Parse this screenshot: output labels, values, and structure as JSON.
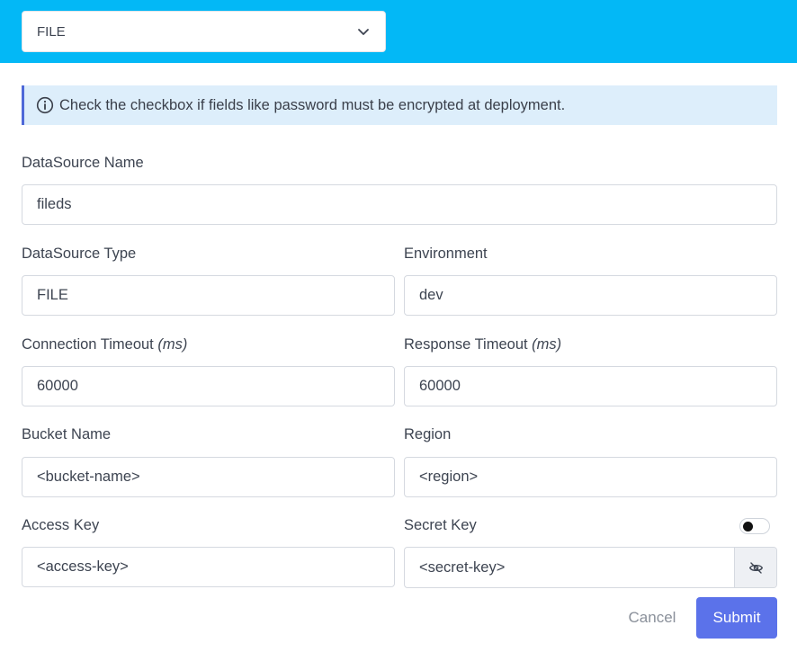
{
  "header": {
    "type_select": {
      "value": "FILE",
      "icon": "chevron-down-icon"
    },
    "background_color": "#03b8f6"
  },
  "info_banner": {
    "icon": "info-circle-icon",
    "text": "Check the checkbox if fields like password must be encrypted at deployment."
  },
  "form": {
    "datasource_name": {
      "label": "DataSource Name",
      "value": "fileds"
    },
    "datasource_type": {
      "label": "DataSource Type",
      "value": "FILE"
    },
    "environment": {
      "label": "Environment",
      "value": "dev"
    },
    "connection_timeout": {
      "label": "Connection Timeout",
      "unit": "(ms)",
      "value": "60000"
    },
    "response_timeout": {
      "label": "Response Timeout",
      "unit": "(ms)",
      "value": "60000"
    },
    "bucket_name": {
      "label": "Bucket Name",
      "value": "<bucket-name>"
    },
    "region": {
      "label": "Region",
      "value": "<region>"
    },
    "access_key": {
      "label": "Access Key",
      "value": "<access-key>"
    },
    "secret_key": {
      "label": "Secret Key",
      "value": "<secret-key>",
      "encrypt_toggle_on": false,
      "visibility_icon": "eye-slash-icon"
    }
  },
  "actions": {
    "cancel_label": "Cancel",
    "submit_label": "Submit",
    "submit_color": "#5b72ea"
  }
}
